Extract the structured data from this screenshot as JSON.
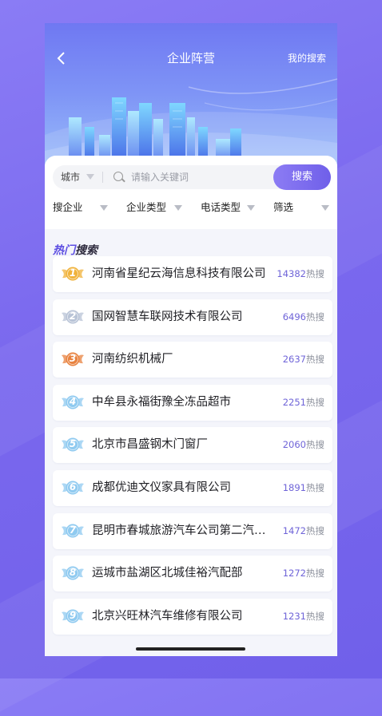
{
  "header": {
    "back_icon": "chevron-left-icon",
    "title": "企业阵营",
    "my_search": "我的搜索"
  },
  "search": {
    "city": "城市",
    "placeholder": "请输入关键词",
    "button": "搜索"
  },
  "filters": [
    "搜企业",
    "企业类型",
    "电话类型",
    "筛选"
  ],
  "hot": {
    "title_a": "热门",
    "title_b": "搜索",
    "suffix": "热搜",
    "items": [
      {
        "rank": "1",
        "name": "河南省星纪云海信息科技有限公司",
        "count": "14382"
      },
      {
        "rank": "2",
        "name": "国网智慧车联网技术有限公司",
        "count": "6496"
      },
      {
        "rank": "3",
        "name": "河南纺织机械厂",
        "count": "2637"
      },
      {
        "rank": "4",
        "name": "中牟县永福街豫全冻品超市",
        "count": "2251"
      },
      {
        "rank": "5",
        "name": "北京市昌盛钢木门窗厂",
        "count": "2060"
      },
      {
        "rank": "6",
        "name": "成都优迪文仪家具有限公司",
        "count": "1891"
      },
      {
        "rank": "7",
        "name": "昆明市春城旅游汽车公司第二汽车修理厂",
        "count": "1472"
      },
      {
        "rank": "8",
        "name": "运城市盐湖区北城佳裕汽配部",
        "count": "1272"
      },
      {
        "rank": "9",
        "name": "北京兴旺林汽车维修有限公司",
        "count": "1231"
      }
    ]
  },
  "colors": {
    "accent": "#6f5fe9",
    "gold": "#f0b23a",
    "silver": "#b8c3d6",
    "bronze": "#e8823f",
    "blue": "#8fcaf0"
  }
}
